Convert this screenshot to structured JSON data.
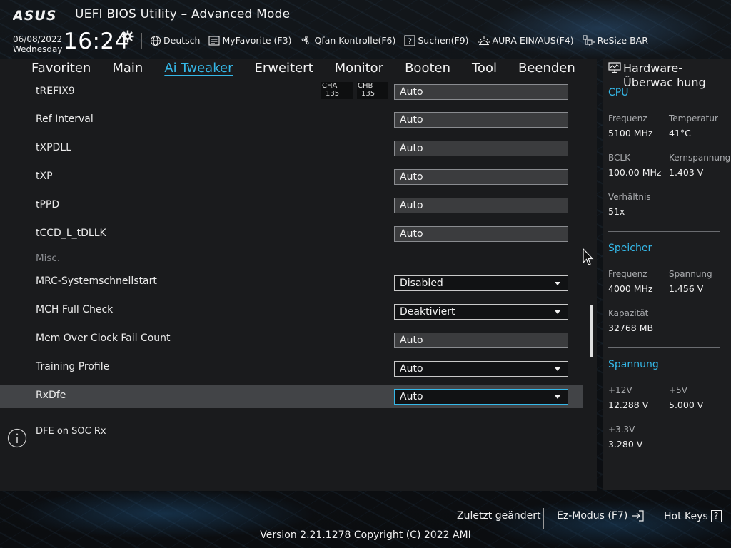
{
  "header": {
    "brand": "ASUS",
    "title": "UEFI BIOS Utility – Advanced Mode",
    "date": "06/08/2022",
    "weekday": "Wednesday",
    "time": "16:24",
    "tools": [
      {
        "label": "Deutsch",
        "icon": "globe-icon"
      },
      {
        "label": "MyFavorite (F3)",
        "icon": "favorite-list-icon"
      },
      {
        "label": "Qfan Kontrolle(F6)",
        "icon": "fan-icon"
      },
      {
        "label": "Suchen(F9)",
        "icon": "search-help-icon"
      },
      {
        "label": "AURA EIN/AUS(F4)",
        "icon": "aura-light-icon"
      },
      {
        "label": "ReSize BAR",
        "icon": "resize-bar-icon"
      }
    ]
  },
  "nav": {
    "tabs": [
      "Favoriten",
      "Main",
      "Ai Tweaker",
      "Erweitert",
      "Monitor",
      "Booten",
      "Tool",
      "Beenden"
    ],
    "active": "Ai Tweaker"
  },
  "settings": {
    "rows": [
      {
        "label": "tREFIX9",
        "value": "Auto",
        "type": "text",
        "channels": [
          {
            "name": "CHA",
            "value": "135"
          },
          {
            "name": "CHB",
            "value": "135"
          }
        ]
      },
      {
        "label": "Ref Interval",
        "value": "Auto",
        "type": "text"
      },
      {
        "label": "tXPDLL",
        "value": "Auto",
        "type": "text"
      },
      {
        "label": "tXP",
        "value": "Auto",
        "type": "text"
      },
      {
        "label": "tPPD",
        "value": "Auto",
        "type": "text"
      },
      {
        "label": "tCCD_L_tDLLK",
        "value": "Auto",
        "type": "text"
      },
      {
        "label": "Misc.",
        "type": "subheader"
      },
      {
        "label": "MRC-Systemschnellstart",
        "value": "Disabled",
        "type": "dropdown"
      },
      {
        "label": "MCH Full Check",
        "value": "Deaktiviert",
        "type": "dropdown"
      },
      {
        "label": "Mem Over Clock Fail Count",
        "value": "Auto",
        "type": "text"
      },
      {
        "label": "Training Profile",
        "value": "Auto",
        "type": "dropdown"
      },
      {
        "label": "RxDfe",
        "value": "Auto",
        "type": "dropdown",
        "selected": true
      }
    ]
  },
  "help": {
    "text": "DFE on SOC Rx"
  },
  "hardware": {
    "title": "Hardware-Überwac hung",
    "cpu": {
      "title": "CPU",
      "freq_label": "Frequenz",
      "freq": "5100 MHz",
      "temp_label": "Temperatur",
      "temp": "41°C",
      "bclk_label": "BCLK",
      "bclk": "100.00 MHz",
      "vcore_label": "Kernspannung",
      "vcore": "1.403 V",
      "ratio_label": "Verhältnis",
      "ratio": "51x"
    },
    "memory": {
      "title": "Speicher",
      "freq_label": "Frequenz",
      "freq": "4000 MHz",
      "volt_label": "Spannung",
      "volt": "1.456 V",
      "cap_label": "Kapazität",
      "cap": "32768 MB"
    },
    "voltage": {
      "title": "Spannung",
      "v12_label": "+12V",
      "v12": "12.288 V",
      "v5_label": "+5V",
      "v5": "5.000 V",
      "v33_label": "+3.3V",
      "v33": "3.280 V"
    }
  },
  "footer": {
    "last_changed": "Zuletzt geändert",
    "ez_mode": "Ez-Modus (F7)",
    "hot_keys": "Hot Keys",
    "hot_keys_key": "?",
    "version": "Version 2.21.1278 Copyright (C) 2022 AMI"
  },
  "colors": {
    "accent": "#35b8e8",
    "panel": "#1a1b1d",
    "selected_row": "#424447"
  }
}
